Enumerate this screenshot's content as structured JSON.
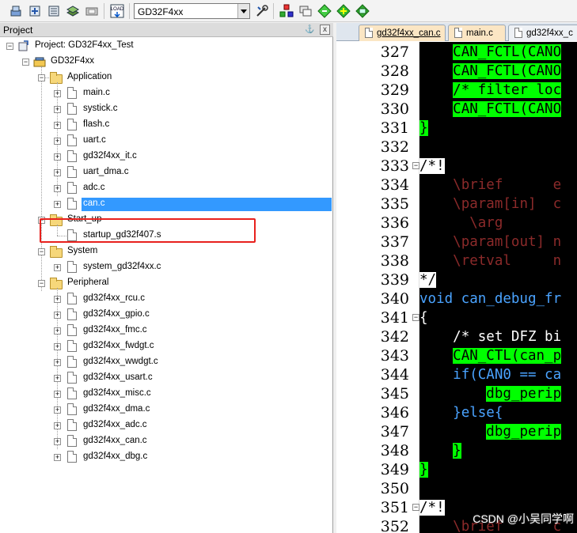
{
  "toolbar": {
    "target_select": {
      "value": "GD32F4xx"
    },
    "icons": [
      "batch-build-icon",
      "translate-icon",
      "rebuild-icon",
      "stack-icon",
      "build-icon",
      "load-icon",
      "target-options-icon",
      "manage-components-icon",
      "pack-installer-icon",
      "select-packs-icon",
      "rte-icon"
    ],
    "load_label": "LOAD"
  },
  "project_panel": {
    "title": "Project",
    "pin": "☰",
    "close": "x",
    "root": "Project: GD32F4xx_Test",
    "target": "GD32F4xx",
    "groups": [
      {
        "name": "Application",
        "files": [
          "main.c",
          "systick.c",
          "flash.c",
          "uart.c",
          "gd32f4xx_it.c",
          "uart_dma.c",
          "adc.c",
          "can.c"
        ]
      },
      {
        "name": "Start_up",
        "files": [
          "startup_gd32f407.s"
        ]
      },
      {
        "name": "System",
        "files": [
          "system_gd32f4xx.c"
        ]
      },
      {
        "name": "Peripheral",
        "files": [
          "gd32f4xx_rcu.c",
          "gd32f4xx_gpio.c",
          "gd32f4xx_fmc.c",
          "gd32f4xx_fwdgt.c",
          "gd32f4xx_wwdgt.c",
          "gd32f4xx_usart.c",
          "gd32f4xx_misc.c",
          "gd32f4xx_dma.c",
          "gd32f4xx_adc.c",
          "gd32f4xx_can.c",
          "gd32f4xx_dbg.c"
        ]
      }
    ],
    "selected_file": "can.c"
  },
  "editor": {
    "tabs": [
      {
        "label": "gd32f4xx_can.c",
        "active": true
      },
      {
        "label": "main.c",
        "active": false
      },
      {
        "label": "gd32f4xx_c",
        "active": false
      }
    ],
    "line_numbers": [
      "327",
      "328",
      "329",
      "330",
      "331",
      "332",
      "333",
      "334",
      "335",
      "336",
      "337",
      "338",
      "339",
      "340",
      "341",
      "342",
      "343",
      "344",
      "345",
      "346",
      "347",
      "348",
      "349",
      "350",
      "351",
      "352"
    ],
    "lines": [
      "    CAN_FCTL(CANO",
      "    CAN_FCTL(CANO",
      "    /* filter loc",
      "    CAN_FCTL(CANO",
      "}",
      "",
      "/*!",
      "    \\brief      e",
      "    \\param[in]  c",
      "      \\arg",
      "    \\param[out] n",
      "    \\retval     n",
      "*/",
      "void can_debug_fr",
      "{",
      "    /* set DFZ bi",
      "    CAN_CTL(can_p",
      "    if(CAN0 == ca",
      "        dbg_perip",
      "    }else{",
      "        dbg_perip",
      "    }",
      "}",
      "",
      "/*!",
      "    \\brief      c"
    ]
  },
  "watermark": "CSDN @小吴同学啊",
  "colors": {
    "selection": "#3399ff",
    "highlight_box": "#e8211d",
    "code_bg": "#000000",
    "code_green": "#00ff00"
  }
}
